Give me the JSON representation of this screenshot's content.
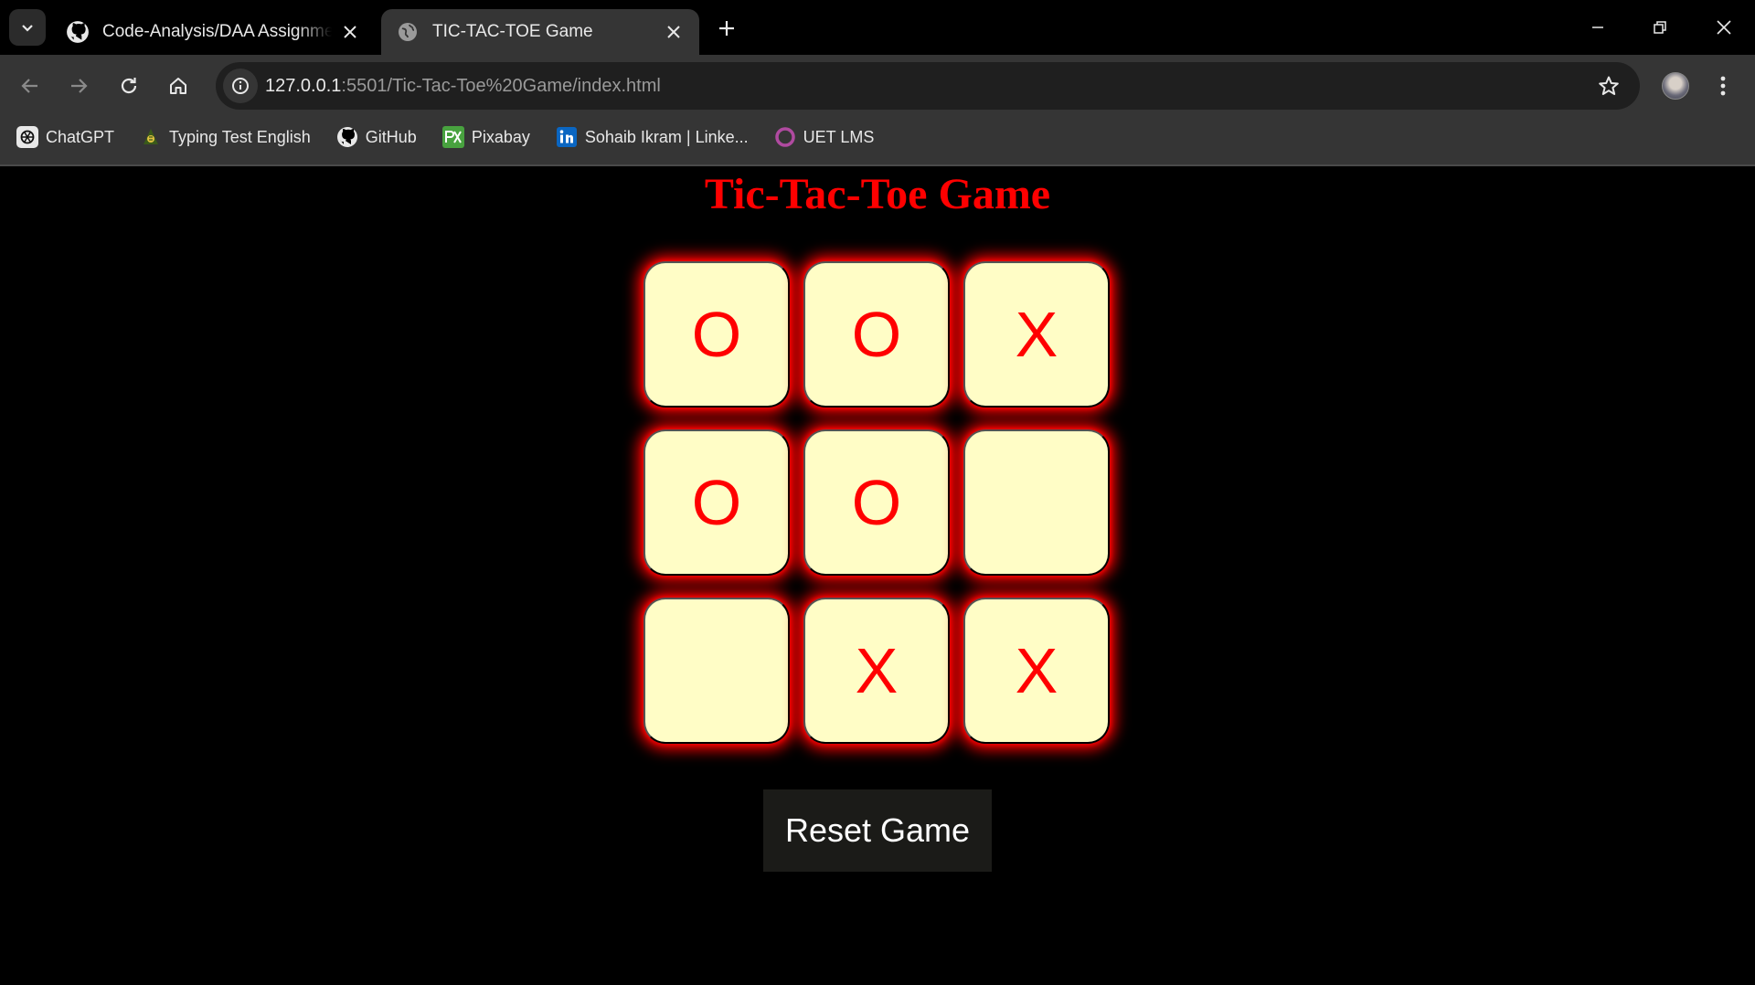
{
  "browser": {
    "tabs": [
      {
        "title": "Code-Analysis/DAA Assignment",
        "favicon": "github-icon",
        "active": false
      },
      {
        "title": "TIC-TAC-TOE Game",
        "favicon": "globe-icon",
        "active": true
      }
    ],
    "address": {
      "host": "127.0.0.1",
      "path": ":5501/Tic-Tac-Toe%20Game/index.html"
    },
    "bookmarks": [
      {
        "label": "ChatGPT",
        "icon": "chatgpt-icon"
      },
      {
        "label": "Typing Test English",
        "icon": "typing-test-icon"
      },
      {
        "label": "GitHub",
        "icon": "github-icon"
      },
      {
        "label": "Pixabay",
        "icon": "pixabay-icon"
      },
      {
        "label": "Sohaib Ikram | Linke...",
        "icon": "linkedin-icon"
      },
      {
        "label": "UET LMS",
        "icon": "uet-lms-icon"
      }
    ]
  },
  "game": {
    "title": "Tic-Tac-Toe Game",
    "board": [
      "O",
      "O",
      "X",
      "O",
      "O",
      "",
      "",
      "X",
      "X"
    ],
    "reset_label": "Reset Game"
  },
  "colors": {
    "accent": "#ff0000",
    "cell_background": "#fffdc6",
    "page_background": "#000000",
    "button_background": "#1b1b18"
  }
}
